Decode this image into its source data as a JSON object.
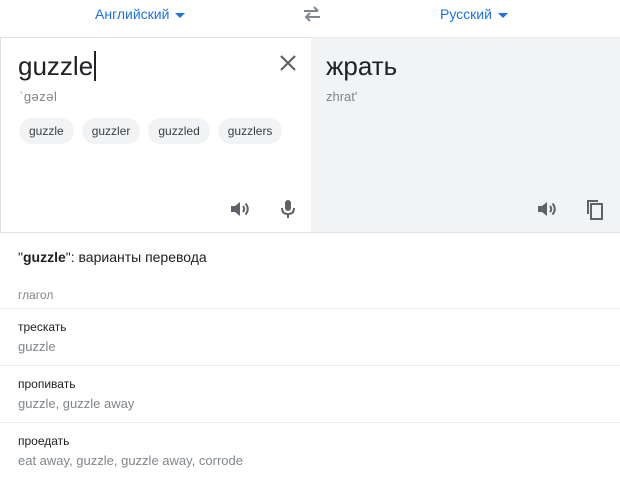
{
  "lang_bar": {
    "source_lang": "Английский",
    "target_lang": "Русский"
  },
  "source": {
    "text": "guzzle",
    "transliteration": "ˈɡəzəl",
    "suggestions": [
      "guzzle",
      "guzzler",
      "guzzled",
      "guzzlers"
    ]
  },
  "target": {
    "text": "жрать",
    "transliteration": "zhrat'"
  },
  "dictionary": {
    "title_word": "guzzle",
    "title_quote_open": "\"",
    "title_rest": "\": варианты перевода",
    "part_of_speech": "глагол",
    "entries": [
      {
        "word": "трескать",
        "synonyms": "guzzle"
      },
      {
        "word": "пропивать",
        "synonyms": "guzzle, guzzle away"
      },
      {
        "word": "проедать",
        "synonyms": "eat away, guzzle, guzzle away, corrode"
      }
    ]
  },
  "colors": {
    "accent": "#1a73e8",
    "target_panel_bg": "#f1f3f4",
    "secondary_text": "#80868b",
    "icon_gray": "#5f6368"
  },
  "icons": [
    "swap-languages-icon",
    "clear-icon",
    "speaker-icon",
    "microphone-icon",
    "copy-icon"
  ]
}
